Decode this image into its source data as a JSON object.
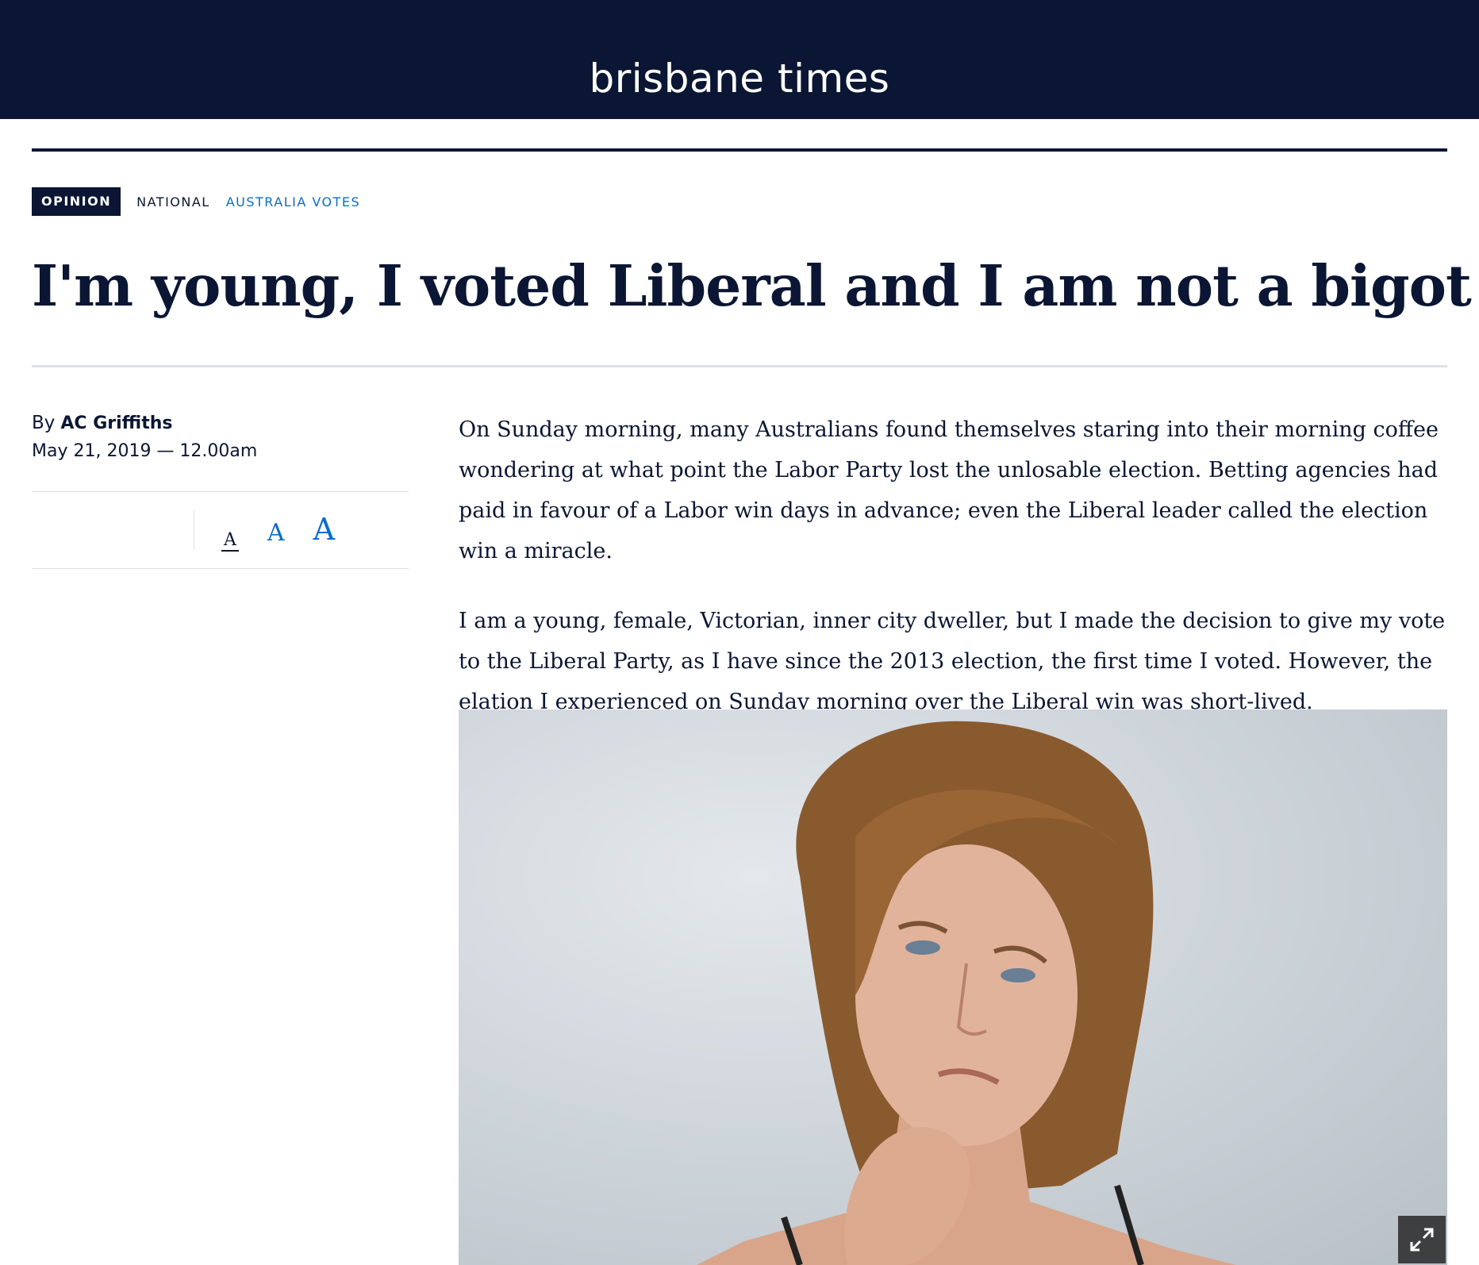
{
  "site": {
    "name": "brisbane times"
  },
  "tags": {
    "opinion": "OPINION",
    "national": "NATIONAL",
    "section": "AUSTRALIA VOTES"
  },
  "article": {
    "headline": "I'm young, I voted Liberal and I am not a bigot",
    "byline_prefix": "By",
    "author": "AC Griffiths",
    "date": "May 21, 2019 — 12.00am",
    "paragraphs": [
      "On Sunday morning, many Australians found themselves staring into their morning coffee wondering at what point the Labor Party lost the unlosable election. Betting agencies had paid in favour of a Labor win days in advance; even the Liberal leader called the election win a miracle.",
      "I am a young, female, Victorian, inner city dweller, but I made the decision to give my vote to the Liberal Party, as I have since the 2013 election, the first time I voted. However, the elation I experienced on Sunday morning over the Liberal win was short-lived."
    ]
  },
  "font_size_controls": {
    "small": "A",
    "medium": "A",
    "large": "A"
  },
  "colors": {
    "navy": "#0a1633",
    "link_blue": "#0a6cc7"
  },
  "icons": {
    "expand": "expand-icon"
  }
}
